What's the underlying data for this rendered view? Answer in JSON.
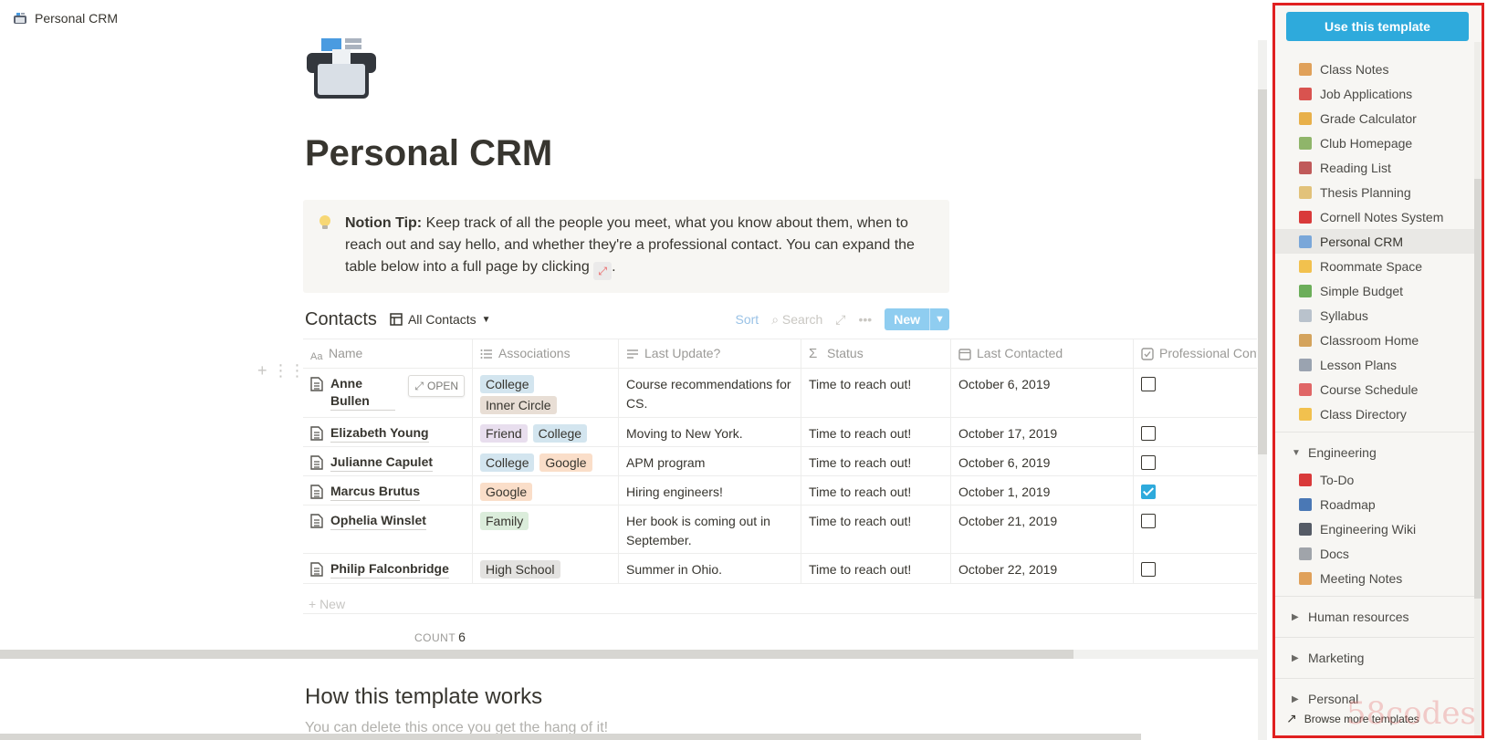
{
  "topbar": {
    "page_name": "Personal CRM"
  },
  "page": {
    "title": "Personal CRM"
  },
  "callout": {
    "tip_label": "Notion Tip:",
    "tip_text": " Keep track of all the people you meet, what you know about them, when to reach out and say hello, and whether they're a professional contact. You can expand the table below into a full page by clicking",
    "tip_end": "."
  },
  "database": {
    "title": "Contacts",
    "view": "All Contacts",
    "tools": {
      "sort": "Sort",
      "search": "Search",
      "new": "New"
    },
    "columns": [
      "Name",
      "Associations",
      "Last Update?",
      "Status",
      "Last Contacted",
      "Professional Cont"
    ],
    "open_label": "OPEN",
    "rows": [
      {
        "name": "Anne Bullen",
        "tags": [
          "College",
          "Inner Circle"
        ],
        "update": "Course recommendations for CS.",
        "status": "Time to reach out!",
        "contacted": "October 6, 2019",
        "pro": false
      },
      {
        "name": "Elizabeth Young",
        "tags": [
          "Friend",
          "College"
        ],
        "update": "Moving to New York.",
        "status": "Time to reach out!",
        "contacted": "October 17, 2019",
        "pro": false
      },
      {
        "name": "Julianne Capulet",
        "tags": [
          "College",
          "Google"
        ],
        "update": "APM program",
        "status": "Time to reach out!",
        "contacted": "October 6, 2019",
        "pro": false
      },
      {
        "name": "Marcus Brutus",
        "tags": [
          "Google"
        ],
        "update": "Hiring engineers!",
        "status": "Time to reach out!",
        "contacted": "October 1, 2019",
        "pro": true
      },
      {
        "name": "Ophelia Winslet",
        "tags": [
          "Family"
        ],
        "update": "Her book is coming out in September.",
        "status": "Time to reach out!",
        "contacted": "October 21, 2019",
        "pro": false
      },
      {
        "name": "Philip Falconbridge",
        "tags": [
          "High School"
        ],
        "update": "Summer in Ohio.",
        "status": "Time to reach out!",
        "contacted": "October 22, 2019",
        "pro": false
      }
    ],
    "new_row": "+ New",
    "count_label": "COUNT",
    "count_value": "6"
  },
  "section": {
    "heading": "How this template works",
    "sub": "You can delete this once you get the hang of it!"
  },
  "sidebar": {
    "use_button": "Use this template",
    "templates": [
      {
        "label": "Class Notes",
        "icon": "pencil-icon",
        "color": "#e0a15a"
      },
      {
        "label": "Job Applications",
        "icon": "crane-icon",
        "color": "#d9534f"
      },
      {
        "label": "Grade Calculator",
        "icon": "abacus-icon",
        "color": "#e8b04a"
      },
      {
        "label": "Club Homepage",
        "icon": "house-icon",
        "color": "#8fb56a"
      },
      {
        "label": "Reading List",
        "icon": "books-icon",
        "color": "#c05a5a"
      },
      {
        "label": "Thesis Planning",
        "icon": "scroll-icon",
        "color": "#e2c27a"
      },
      {
        "label": "Cornell Notes System",
        "icon": "pin-icon",
        "color": "#d93a3a"
      },
      {
        "label": "Personal CRM",
        "icon": "card-index-icon",
        "color": "#7aa7d9",
        "active": true
      },
      {
        "label": "Roommate Space",
        "icon": "hand-icon",
        "color": "#f2c14e"
      },
      {
        "label": "Simple Budget",
        "icon": "money-icon",
        "color": "#6cae5a"
      },
      {
        "label": "Syllabus",
        "icon": "document-icon",
        "color": "#b9c2cc"
      },
      {
        "label": "Classroom Home",
        "icon": "school-icon",
        "color": "#d4a35c"
      },
      {
        "label": "Lesson Plans",
        "icon": "ledger-icon",
        "color": "#9aa3b0"
      },
      {
        "label": "Course Schedule",
        "icon": "calendar-icon",
        "color": "#e06666"
      },
      {
        "label": "Class Directory",
        "icon": "wave-icon",
        "color": "#f2c14e"
      }
    ],
    "engineering_group": "Engineering",
    "engineering": [
      {
        "label": "To-Do",
        "icon": "boxing-glove-icon",
        "color": "#d93a3a"
      },
      {
        "label": "Roadmap",
        "icon": "car-icon",
        "color": "#4a78b5"
      },
      {
        "label": "Engineering Wiki",
        "icon": "notebook-icon",
        "color": "#555b66"
      },
      {
        "label": "Docs",
        "icon": "paperclip-icon",
        "color": "#a0a4aa"
      },
      {
        "label": "Meeting Notes",
        "icon": "pencil-icon",
        "color": "#e0a15a"
      }
    ],
    "groups": [
      "Human resources",
      "Marketing",
      "Personal"
    ],
    "browse": "Browse more templates",
    "watermark": "58codes"
  }
}
